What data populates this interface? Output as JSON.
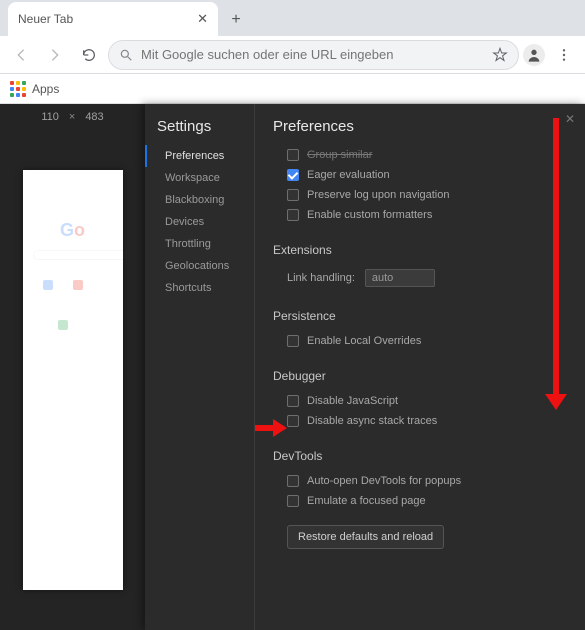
{
  "window": {
    "tab_title": "Neuer Tab"
  },
  "toolbar": {
    "omnibox_placeholder": "Mit Google suchen oder eine URL eingeben"
  },
  "bookmarks": {
    "apps_label": "Apps"
  },
  "device": {
    "width": "110",
    "height": "483"
  },
  "settings": {
    "title": "Settings",
    "sidebar": {
      "items": [
        {
          "label": "Preferences",
          "active": true
        },
        {
          "label": "Workspace"
        },
        {
          "label": "Blackboxing"
        },
        {
          "label": "Devices"
        },
        {
          "label": "Throttling"
        },
        {
          "label": "Geolocations"
        },
        {
          "label": "Shortcuts"
        }
      ]
    },
    "content": {
      "heading": "Preferences",
      "groups": [
        {
          "options": [
            {
              "label": "Group similar",
              "checked": false,
              "strike": true
            },
            {
              "label": "Eager evaluation",
              "checked": true
            },
            {
              "label": "Preserve log upon navigation",
              "checked": false
            },
            {
              "label": "Enable custom formatters",
              "checked": false
            }
          ]
        },
        {
          "title": "Extensions",
          "field": {
            "label": "Link handling:",
            "value": "auto"
          }
        },
        {
          "title": "Persistence",
          "options": [
            {
              "label": "Enable Local Overrides",
              "checked": false
            }
          ]
        },
        {
          "title": "Debugger",
          "options": [
            {
              "label": "Disable JavaScript",
              "checked": false
            },
            {
              "label": "Disable async stack traces",
              "checked": false
            }
          ]
        },
        {
          "title": "DevTools",
          "options": [
            {
              "label": "Auto-open DevTools for popups",
              "checked": false
            },
            {
              "label": "Emulate a focused page",
              "checked": false
            }
          ]
        }
      ],
      "restore_label": "Restore defaults and reload"
    }
  }
}
